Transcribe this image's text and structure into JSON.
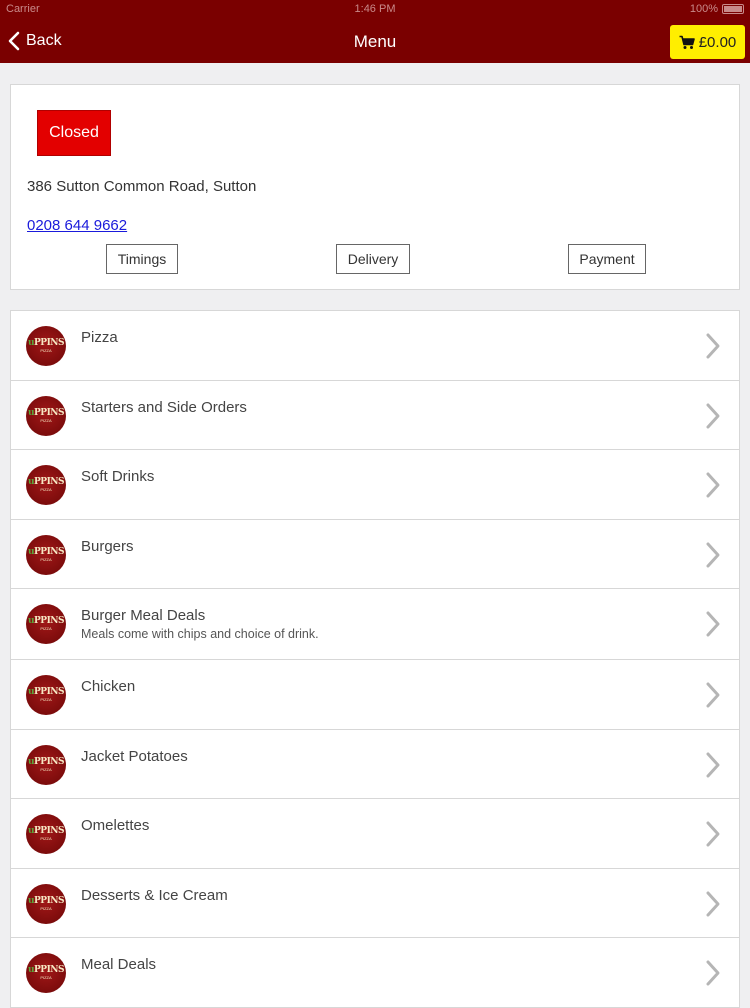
{
  "status_bar": {
    "carrier": "Carrier",
    "time": "1:46 PM",
    "battery": "100%"
  },
  "nav": {
    "back_label": "Back",
    "title": "Menu",
    "cart_total": "£0.00"
  },
  "store": {
    "status": "Closed",
    "address": "386 Sutton Common Road, Sutton",
    "phone": "0208 644 9662",
    "buttons": {
      "timings": "Timings",
      "delivery": "Delivery",
      "payment": "Payment"
    }
  },
  "categories": [
    {
      "title": "Pizza",
      "subtitle": ""
    },
    {
      "title": "Starters and Side Orders",
      "subtitle": ""
    },
    {
      "title": "Soft Drinks",
      "subtitle": ""
    },
    {
      "title": "Burgers",
      "subtitle": ""
    },
    {
      "title": "Burger Meal Deals",
      "subtitle": "Meals come with chips and choice of drink."
    },
    {
      "title": "Chicken",
      "subtitle": ""
    },
    {
      "title": "Jacket Potatoes",
      "subtitle": ""
    },
    {
      "title": "Omelettes",
      "subtitle": ""
    },
    {
      "title": "Desserts & Ice Cream",
      "subtitle": ""
    },
    {
      "title": "Meal Deals",
      "subtitle": ""
    }
  ],
  "logo": {
    "text_main": "PPINS",
    "text_accent": "u",
    "text_sub": "PIZZA"
  },
  "colors": {
    "header": "#7a0000",
    "cart": "#ffee00",
    "closed": "#e30000",
    "link": "#1a1adb"
  },
  "icons": {
    "back": "chevron-left-icon",
    "cart": "cart-icon",
    "row": "chevron-right-icon"
  }
}
